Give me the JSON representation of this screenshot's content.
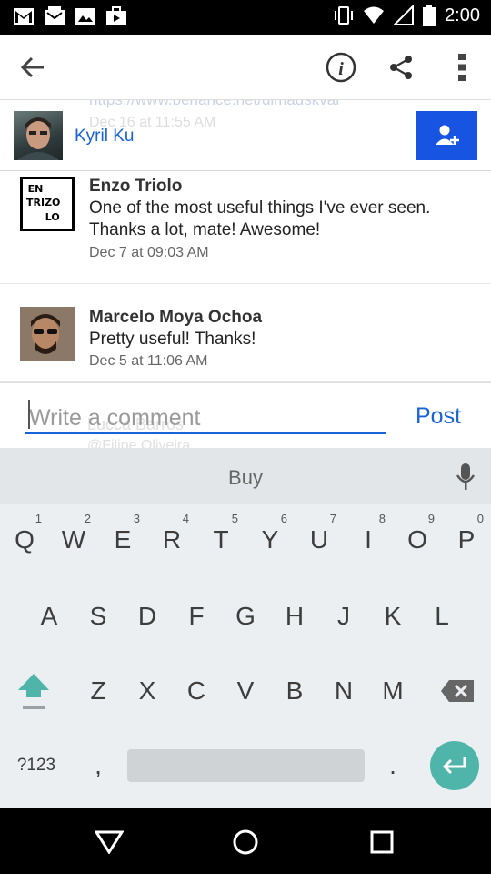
{
  "status_bar": {
    "time": "2:00",
    "icons": [
      "gmail-icon",
      "inbox-icon",
      "photos-icon",
      "store-icon",
      "vibrate-icon",
      "wifi-icon",
      "signal-icon",
      "battery-icon"
    ]
  },
  "toolbar": {
    "icons": [
      "back-arrow-icon",
      "info-icon",
      "share-icon",
      "overflow-menu-icon"
    ]
  },
  "header_user": {
    "name": "Kyril Ku",
    "behind_url": "https://www.behance.net/dimadskvar",
    "behind_date": "Dec 16 at 11:55 AM",
    "follow_icon": "add-user-icon",
    "follow_color": "#1754e2"
  },
  "comments": [
    {
      "author": "Enzo Triolo",
      "text": "One of the most useful things I've ever seen. Thanks a lot, mate! Awesome!",
      "date": "Dec 7 at 09:03 AM",
      "logo": [
        "EN",
        "ZO",
        "",
        "TRI",
        "O",
        "LO"
      ]
    },
    {
      "author": "Marcelo Moya Ochoa",
      "text": "Pretty useful! Thanks!",
      "date": "Dec 5 at 11:06 AM"
    }
  ],
  "composer": {
    "placeholder": "Write a comment",
    "post_label": "Post",
    "behind_name": "Lucca Barros",
    "behind_handle": "@Filipe Oliveira"
  },
  "keyboard": {
    "suggestion": "Buy",
    "row1": [
      {
        "k": "Q",
        "n": "1"
      },
      {
        "k": "W",
        "n": "2"
      },
      {
        "k": "E",
        "n": "3"
      },
      {
        "k": "R",
        "n": "4"
      },
      {
        "k": "T",
        "n": "5"
      },
      {
        "k": "Y",
        "n": "6"
      },
      {
        "k": "U",
        "n": "7"
      },
      {
        "k": "I",
        "n": "8"
      },
      {
        "k": "O",
        "n": "9"
      },
      {
        "k": "P",
        "n": "0"
      }
    ],
    "row2": [
      "A",
      "S",
      "D",
      "F",
      "G",
      "H",
      "J",
      "K",
      "L"
    ],
    "row3": [
      "Z",
      "X",
      "C",
      "V",
      "B",
      "N",
      "M"
    ],
    "symbols_label": "?123",
    "comma": ",",
    "period": ".",
    "accent_color": "#4fb4a9"
  },
  "nav_bar": {
    "icons": [
      "back-triangle-icon",
      "home-circle-icon",
      "recents-square-icon"
    ]
  }
}
